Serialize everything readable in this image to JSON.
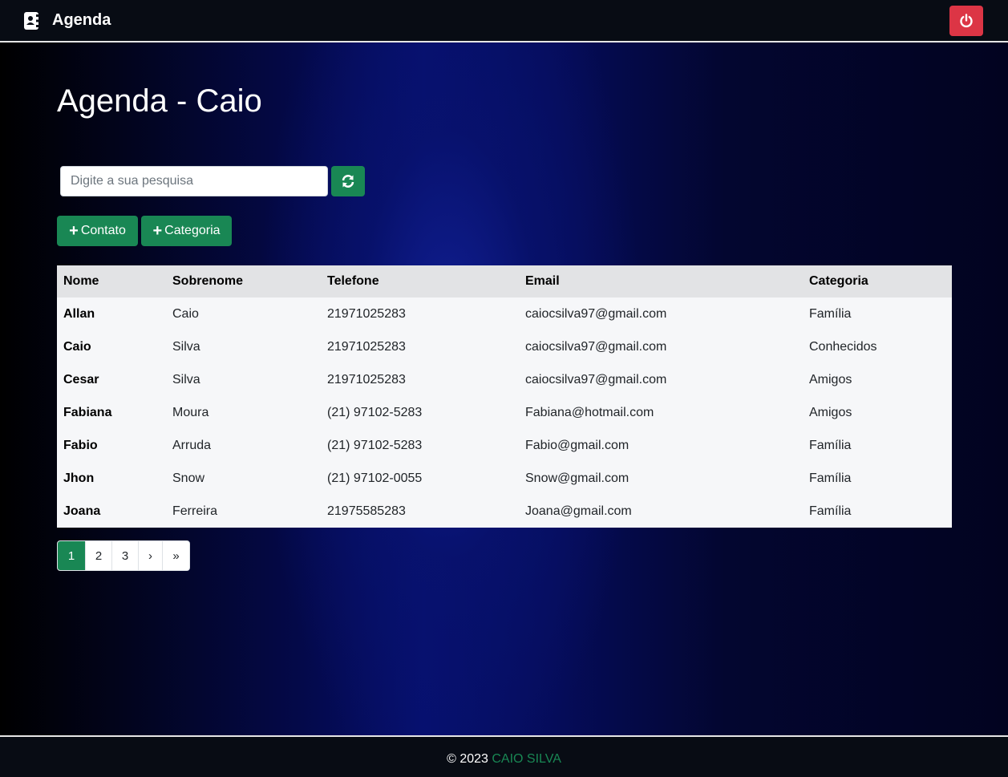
{
  "navbar": {
    "brand": "Agenda",
    "brand_icon": "address-book-icon",
    "logout_icon": "power-icon",
    "logout_color": "#dc3545"
  },
  "page": {
    "title": "Agenda - Caio"
  },
  "search": {
    "placeholder": "Digite a sua pesquisa",
    "value": "",
    "refresh_icon": "refresh-icon"
  },
  "actions": {
    "add_contact": "Contato",
    "add_category": "Categoria",
    "accent": "#198754"
  },
  "table": {
    "headers": [
      "Nome",
      "Sobrenome",
      "Telefone",
      "Email",
      "Categoria"
    ],
    "rows": [
      [
        "Allan",
        "Caio",
        "21971025283",
        "caiocsilva97@gmail.com",
        "Família"
      ],
      [
        "Caio",
        "Silva",
        "21971025283",
        "caiocsilva97@gmail.com",
        "Conhecidos"
      ],
      [
        "Cesar",
        "Silva",
        "21971025283",
        "caiocsilva97@gmail.com",
        "Amigos"
      ],
      [
        "Fabiana",
        "Moura",
        "(21) 97102-5283",
        "Fabiana@hotmail.com",
        "Amigos"
      ],
      [
        "Fabio",
        "Arruda",
        "(21) 97102-5283",
        "Fabio@gmail.com",
        "Família"
      ],
      [
        "Jhon",
        "Snow",
        "(21) 97102-0055",
        "Snow@gmail.com",
        "Família"
      ],
      [
        "Joana",
        "Ferreira",
        "21975585283",
        "Joana@gmail.com",
        "Família"
      ]
    ]
  },
  "pagination": {
    "pages": [
      "1",
      "2",
      "3",
      "›",
      "»"
    ],
    "active": "1"
  },
  "footer": {
    "copyright": "© 2023",
    "author": "CAIO SILVA"
  }
}
